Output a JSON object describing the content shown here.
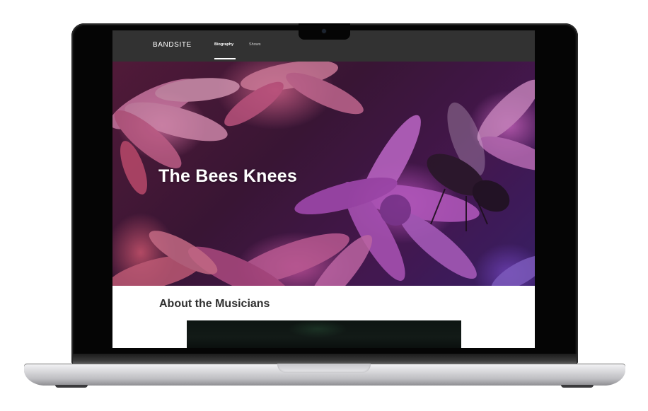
{
  "nav": {
    "logo": "BANDSITE",
    "links": [
      {
        "label": "Biography",
        "active": true
      },
      {
        "label": "Shows",
        "active": false
      }
    ]
  },
  "hero": {
    "title": "The Bees Knees",
    "image": "purple-flowers-with-bee"
  },
  "about": {
    "title": "About the Musicians",
    "image": "musicians-photo"
  },
  "device": {
    "type": "laptop",
    "icons": [
      "camera-icon"
    ]
  },
  "colors": {
    "nav_bg": "#323232",
    "nav_text": "#ffffff",
    "page_bg": "#ffffff",
    "heading_text": "#2f2f2f"
  }
}
